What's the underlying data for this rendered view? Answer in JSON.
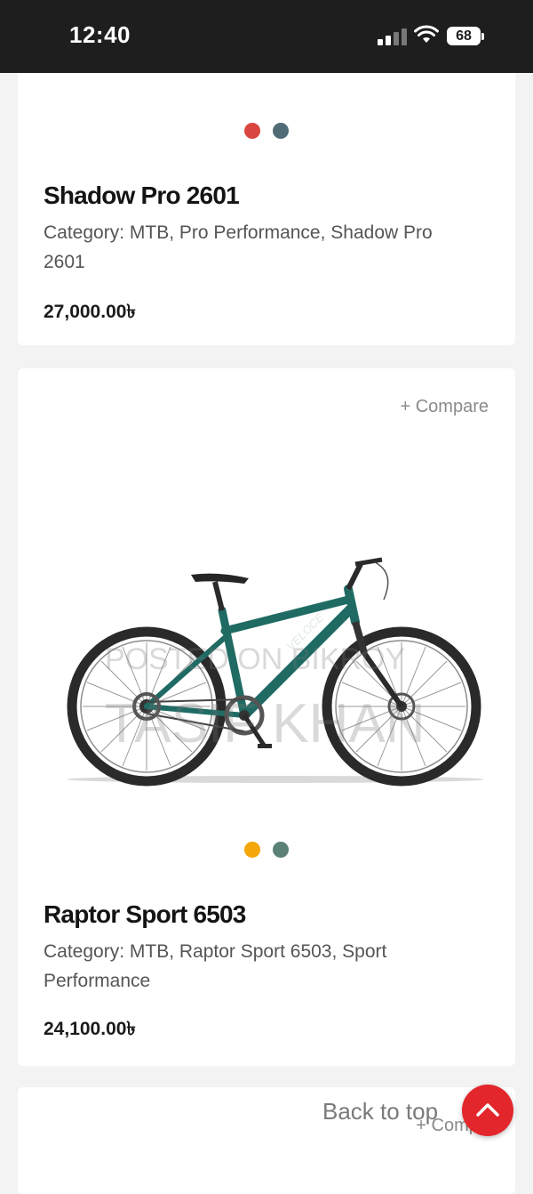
{
  "status_bar": {
    "time": "12:40",
    "battery": "68"
  },
  "products": [
    {
      "title": "Shadow Pro 2601",
      "category": "Category: MTB, Pro Performance, Shadow Pro 2601",
      "price": "27,000.00৳",
      "swatches": [
        "#d9463f",
        "#4f6b76"
      ]
    },
    {
      "compare_label": "+ Compare",
      "bike_frame_color": "#1f6b64",
      "title": "Raptor Sport 6503",
      "category": "Category: MTB, Raptor Sport 6503, Sport Performance",
      "price": "24,100.00৳",
      "swatches": [
        "#f5a60a",
        "#5b8078"
      ]
    },
    {
      "compare_label": "+ Compa"
    }
  ],
  "watermark": {
    "line1": "POSTED ON BIKROY",
    "line2": "TASIF KHAN"
  },
  "back_to_top": {
    "label": "Back to top"
  },
  "colors": {
    "accent": "#e3262b"
  }
}
